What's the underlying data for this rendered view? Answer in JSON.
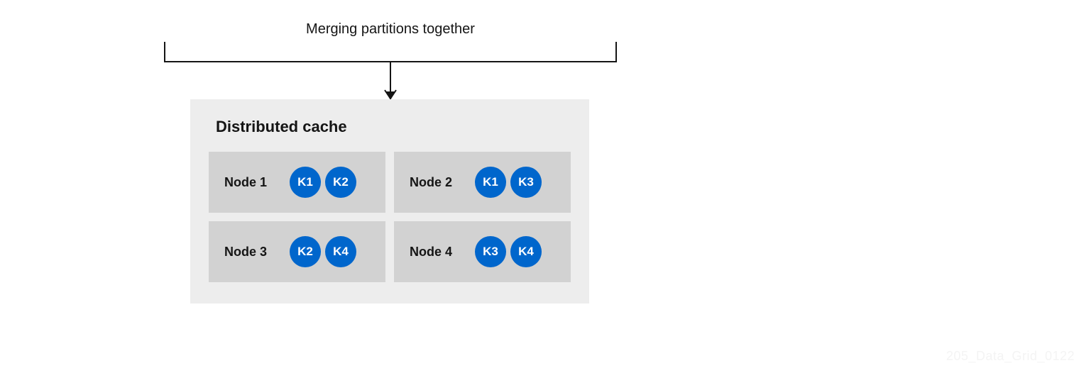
{
  "bracket": {
    "label": "Merging partitions together"
  },
  "cache": {
    "title": "Distributed cache",
    "nodes": [
      {
        "label": "Node 1",
        "keys": [
          "K1",
          "K2"
        ]
      },
      {
        "label": "Node 2",
        "keys": [
          "K1",
          "K3"
        ]
      },
      {
        "label": "Node 3",
        "keys": [
          "K2",
          "K4"
        ]
      },
      {
        "label": "Node 4",
        "keys": [
          "K3",
          "K4"
        ]
      }
    ]
  },
  "watermark": "205_Data_Grid_0122",
  "colors": {
    "key_bg": "#0066cc",
    "panel_bg": "#ededed",
    "node_bg": "#d2d2d2"
  }
}
